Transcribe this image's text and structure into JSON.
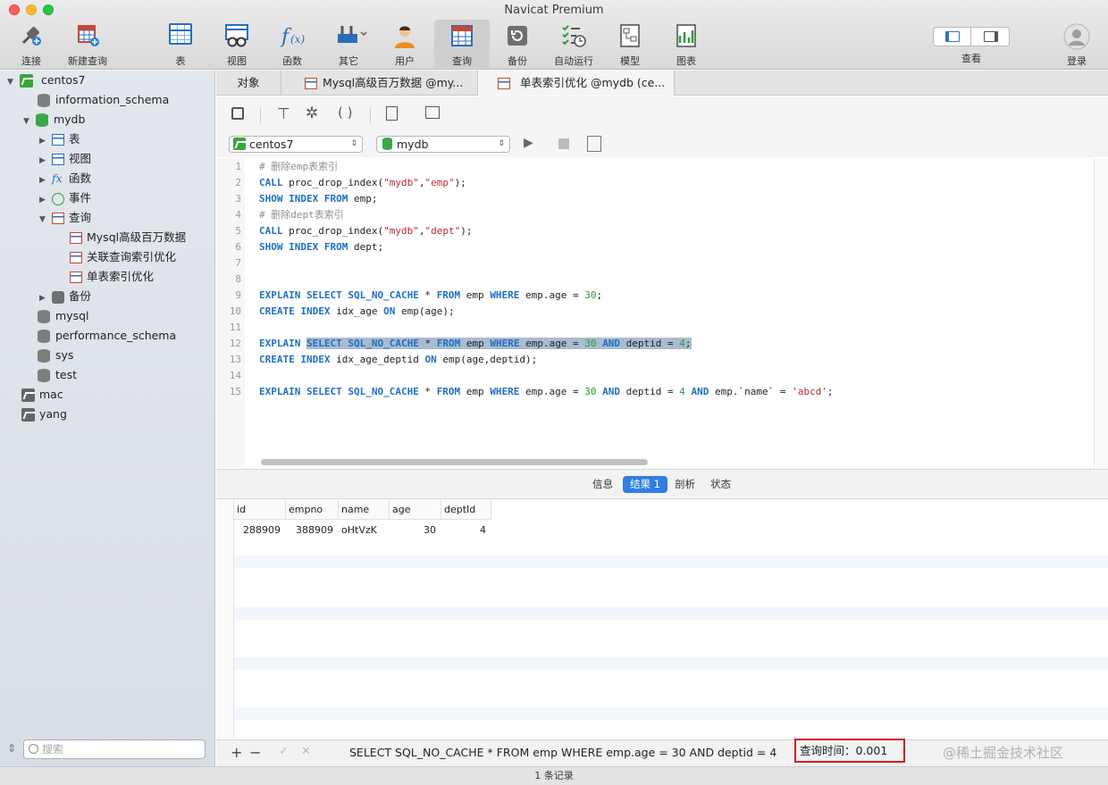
{
  "window": {
    "title": "Navicat Premium"
  },
  "toolbar": {
    "connect": "连接",
    "new_query": "新建查询",
    "table": "表",
    "view": "视图",
    "function": "函数",
    "other": "其它",
    "user": "用户",
    "query": "查询",
    "backup": "备份",
    "automation": "自动运行",
    "model": "模型",
    "chart": "图表",
    "view_mode": "查看",
    "login": "登录"
  },
  "sidebar": {
    "connections": [
      {
        "label": "centos7"
      },
      {
        "label": "mac"
      },
      {
        "label": "yang"
      }
    ],
    "databases": {
      "information_schema": "information_schema",
      "mydb": "mydb",
      "mysql": "mysql",
      "performance_schema": "performance_schema",
      "sys": "sys",
      "test": "test"
    },
    "mydb_children": {
      "tables": "表",
      "views": "视图",
      "functions": "函数",
      "events": "事件",
      "queries": "查询",
      "backups": "备份"
    },
    "queries": [
      "Mysql高级百万数据",
      "关联查询索引优化",
      "单表索引优化"
    ],
    "search_placeholder": "搜索"
  },
  "tabs": [
    {
      "label": "对象"
    },
    {
      "label": "Mysql高级百万数据 @my..."
    },
    {
      "label": "单表索引优化 @mydb (ce..."
    }
  ],
  "controls": {
    "connection_select": "centos7",
    "database_select": "mydb"
  },
  "editor": {
    "line_numbers": [
      "1",
      "2",
      "3",
      "4",
      "5",
      "6",
      "7",
      "8",
      "9",
      "10",
      "11",
      "12",
      "13",
      "14",
      "15"
    ]
  },
  "results": {
    "tabs": [
      "信息",
      "结果 1",
      "剖析",
      "状态"
    ],
    "columns": [
      "id",
      "empno",
      "name",
      "age",
      "deptId"
    ],
    "rows": [
      [
        "288909",
        "388909",
        "oHtVzK",
        "30",
        "4"
      ]
    ]
  },
  "status": {
    "sql": "SELECT SQL_NO_CACHE * FROM emp WHERE emp.age = 30 AND deptid = 4",
    "query_time": "查询时间：0.001",
    "watermark": "@稀土掘金技术社区",
    "record_count": "1 条记录"
  }
}
